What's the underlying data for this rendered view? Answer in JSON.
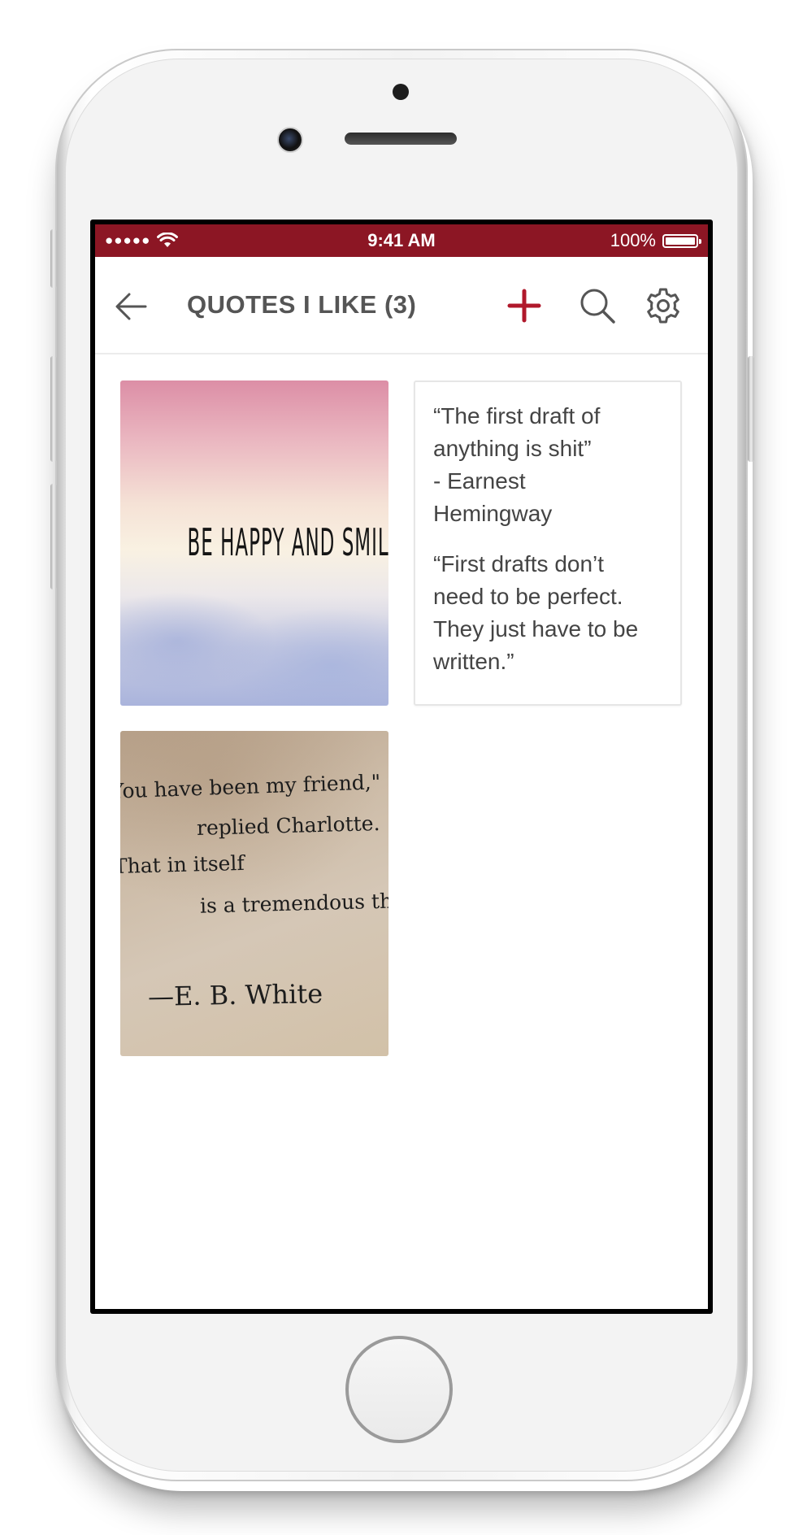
{
  "status_bar": {
    "signal": "●●●●●",
    "time": "9:41 AM",
    "battery_percent": "100%",
    "battery_level": 1.0
  },
  "nav": {
    "title": "QUOTES I LIKE (3)",
    "back_icon": "arrow-left-icon",
    "add_icon": "plus-icon",
    "search_icon": "search-icon",
    "settings_icon": "gear-icon"
  },
  "cards": {
    "image_quote_1": {
      "text": "BE HAPPY AND SMILE"
    },
    "text_quote": {
      "quote_1": "“The first draft of\nanything is shit”\n- Earnest\nHemingway",
      "quote_2": "“First drafts don’t\nneed to be perfect.\nThey just have to be\nwritten.”"
    },
    "image_quote_2": {
      "line_1": "You have been my friend,\"",
      "line_2": "replied Charlotte.",
      "line_3": "That in itself",
      "line_4": "is a tremendous thing.",
      "line_5": "—E. B. White"
    }
  },
  "colors": {
    "brand": "#8c1624",
    "accent": "#b0182b",
    "title_text": "#555555"
  }
}
